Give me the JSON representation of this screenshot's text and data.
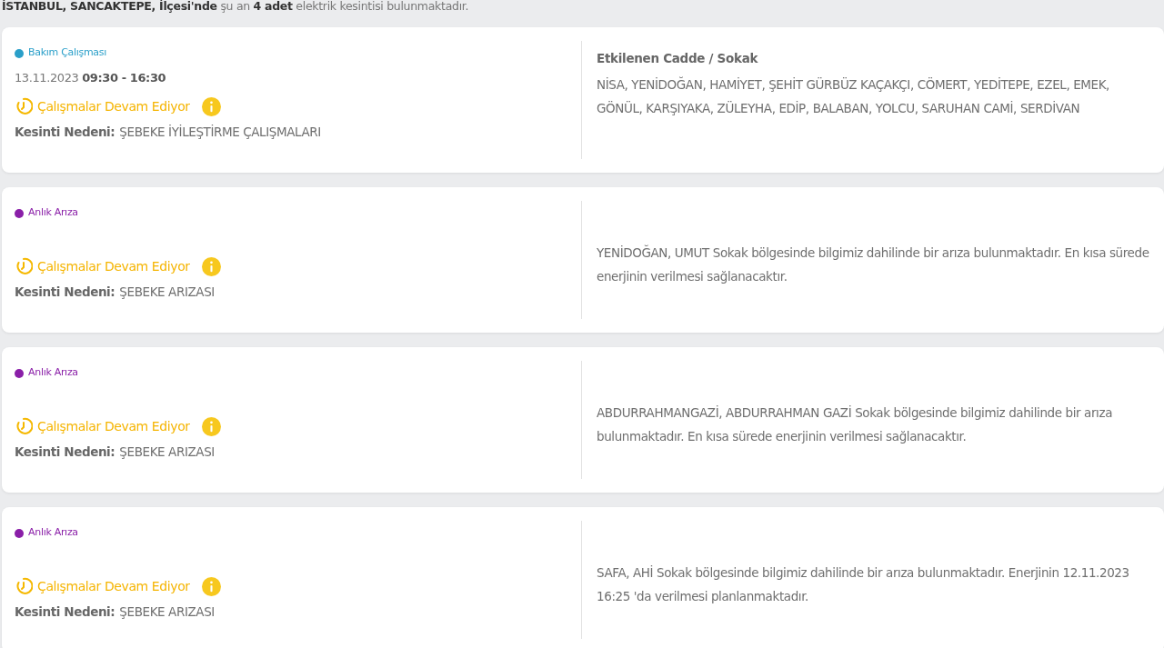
{
  "summary": "**İSTANBUL, SANCAKTEPE, İlçesi'nde** şu an **4 adet** elektrik kesintisi bulunmaktadır.",
  "outages": [
    {
      "type": "Bakım Çalışması",
      "color": "#2a9fc9",
      "date": "13.11.2023 **09:30 - 16:30**",
      "status": "Çalışmalar Devam Ediyor",
      "reason_label": "Kesinti Nedeni:",
      "reason": "ŞEBEKE İYİLEŞTİRME ÇALIŞMALARI",
      "streets_title": "Etkilenen Cadde / Sokak",
      "description": "NİSA, YENİDOĞAN, HAMİYET, ŞEHİT GÜRBÜZ KAÇAKÇI, CÖMERT, YEDİTEPE, EZEL, EMEK, GÖNÜL, KARŞIYAKA, ZÜLEYHA, EDİP, BALABAN, YOLCU, SARUHAN CAMİ, SERDİVAN"
    },
    {
      "type": "Anlık Arıza",
      "color": "#8a1fa8",
      "status": "Çalışmalar Devam Ediyor",
      "reason_label": "Kesinti Nedeni:",
      "reason": "ŞEBEKE ARIZASI",
      "description": "YENİDOĞAN, UMUT Sokak bölgesinde bilgimiz dahilinde bir arıza bulunmaktadır. En kısa sürede enerjinin verilmesi sağlanacaktır."
    },
    {
      "type": "Anlık Arıza",
      "color": "#8a1fa8",
      "status": "Çalışmalar Devam Ediyor",
      "reason_label": "Kesinti Nedeni:",
      "reason": "ŞEBEKE ARIZASI",
      "description": "ABDURRAHMANGAZİ, ABDURRAHMAN GAZİ Sokak bölgesinde bilgimiz dahilinde bir arıza bulunmaktadır. En kısa sürede enerjinin verilmesi sağlanacaktır."
    },
    {
      "type": "Anlık Arıza",
      "color": "#8a1fa8",
      "status": "Çalışmalar Devam Ediyor",
      "reason_label": "Kesinti Nedeni:",
      "reason": "ŞEBEKE ARIZASI",
      "description": "SAFA, AHİ Sokak bölgesinde bilgimiz dahilinde bir arıza bulunmaktadır. Enerjinin 12.11.2023 16:25 'da verilmesi planlanmaktadır."
    }
  ]
}
